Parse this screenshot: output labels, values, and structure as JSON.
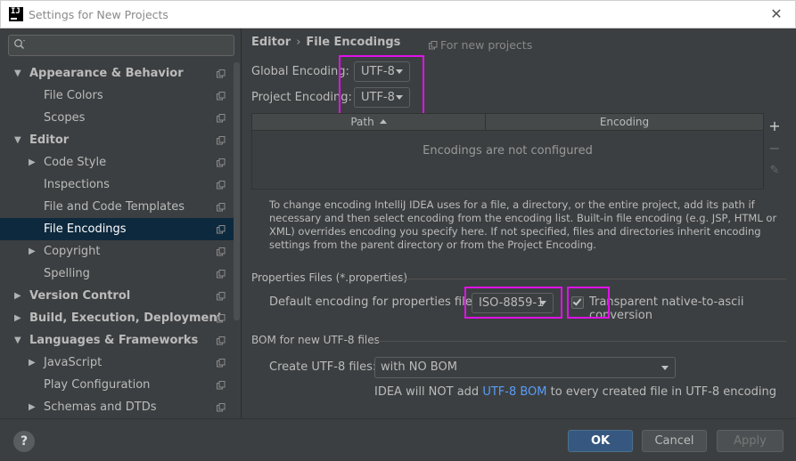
{
  "window": {
    "title": "Settings for New Projects"
  },
  "sidebar": {
    "search": {
      "value": "",
      "placeholder": ""
    },
    "items": [
      {
        "label": "Appearance & Behavior",
        "level": 0,
        "arrow": "▼",
        "bold": true
      },
      {
        "label": "File Colors",
        "level": 1,
        "arrow": "",
        "bold": false
      },
      {
        "label": "Scopes",
        "level": 1,
        "arrow": "",
        "bold": false
      },
      {
        "label": "Editor",
        "level": 0,
        "arrow": "▼",
        "bold": true
      },
      {
        "label": "Code Style",
        "level": 1,
        "arrow": "▶",
        "bold": false
      },
      {
        "label": "Inspections",
        "level": 1,
        "arrow": "",
        "bold": false
      },
      {
        "label": "File and Code Templates",
        "level": 1,
        "arrow": "",
        "bold": false
      },
      {
        "label": "File Encodings",
        "level": 1,
        "arrow": "",
        "bold": false,
        "selected": true
      },
      {
        "label": "Copyright",
        "level": 1,
        "arrow": "▶",
        "bold": false
      },
      {
        "label": "Spelling",
        "level": 1,
        "arrow": "",
        "bold": false
      },
      {
        "label": "Version Control",
        "level": 0,
        "arrow": "▶",
        "bold": true
      },
      {
        "label": "Build, Execution, Deployment",
        "level": 0,
        "arrow": "▶",
        "bold": true
      },
      {
        "label": "Languages & Frameworks",
        "level": 0,
        "arrow": "▼",
        "bold": true
      },
      {
        "label": "JavaScript",
        "level": 1,
        "arrow": "▶",
        "bold": false
      },
      {
        "label": "Play Configuration",
        "level": 1,
        "arrow": "",
        "bold": false
      },
      {
        "label": "Schemas and DTDs",
        "level": 1,
        "arrow": "▶",
        "bold": false
      }
    ]
  },
  "main": {
    "breadcrumb": {
      "parent": "Editor",
      "separator": "›",
      "current": "File Encodings"
    },
    "scope_note": "For new projects",
    "global_encoding": {
      "label": "Global Encoding:",
      "value": "UTF-8"
    },
    "project_encoding": {
      "label": "Project Encoding:",
      "value": "UTF-8"
    },
    "table": {
      "columns": [
        "Path",
        "Encoding"
      ],
      "empty_message": "Encodings are not configured",
      "tools": {
        "add": "+",
        "remove": "−",
        "edit": "✎"
      }
    },
    "help_text": "To change encoding IntelliJ IDEA uses for a file, a directory, or the entire project, add its path if necessary and then select encoding from the encoding list. Built-in file encoding (e.g. JSP, HTML or XML) overrides encoding you specify here. If not specified, files and directories inherit encoding settings from the parent directory or from the Project Encoding.",
    "properties_section": {
      "title": "Properties Files (*.properties)",
      "default_label": "Default encoding for properties files:",
      "default_value": "ISO-8859-1",
      "transparent_label": "Transparent native-to-ascii conversion",
      "transparent_checked": true
    },
    "bom_section": {
      "title": "BOM for new UTF-8 files",
      "create_label": "Create UTF-8 files:",
      "create_value": "with NO BOM",
      "note_before": "IDEA will NOT add ",
      "note_link": "UTF-8 BOM",
      "note_after": " to every created file in UTF-8 encoding"
    }
  },
  "footer": {
    "help_label": "?",
    "ok_label": "OK",
    "cancel_label": "Cancel",
    "apply_label": "Apply"
  },
  "colors": {
    "background": "#3c3f41",
    "selection": "#0d293e",
    "ok_button": "#365880",
    "highlight_box": "#e011e9",
    "link": "#589df6"
  }
}
